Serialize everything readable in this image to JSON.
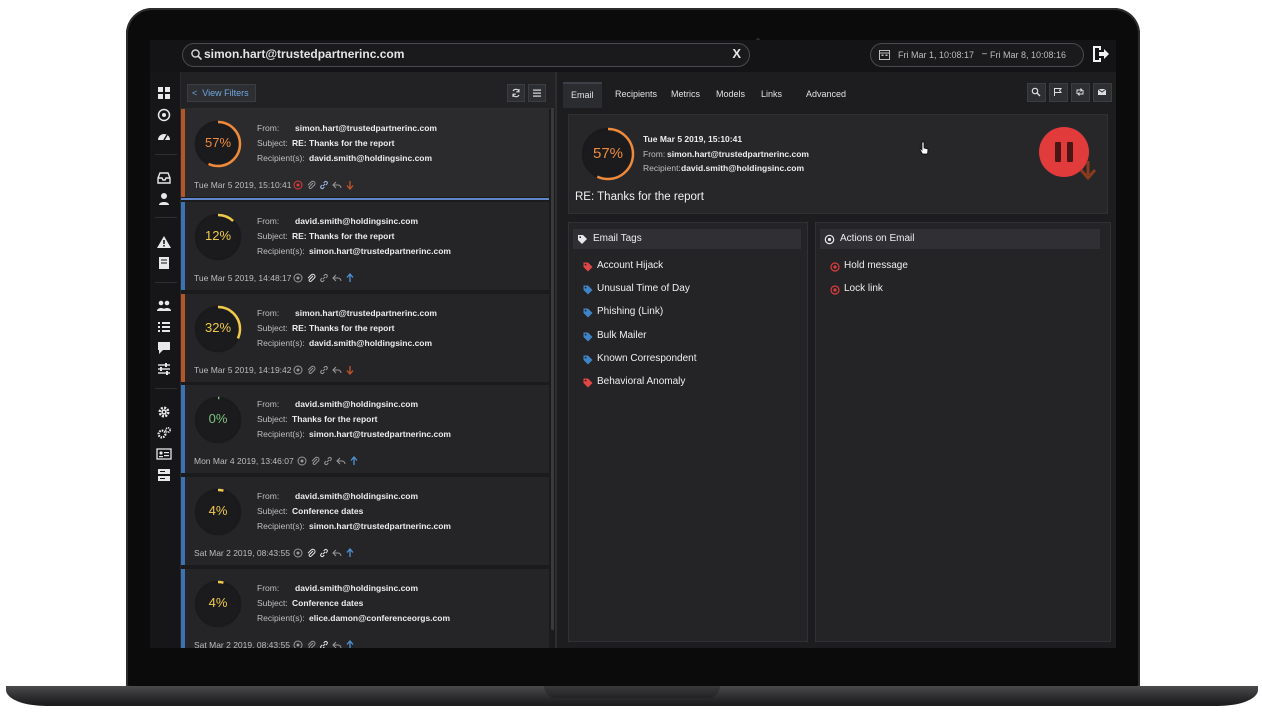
{
  "search": {
    "query": "simon.hart@trustedpartnerinc.com",
    "clear_label": "X"
  },
  "date_range": {
    "from": "Fri Mar 1, 10:08:17",
    "to": "Fri Mar 8, 10:08:16"
  },
  "list": {
    "view_filters_label": "View Filters",
    "field_labels": {
      "from": "From:",
      "subject": "Subject:",
      "recipients": "Recipient(s):"
    },
    "emails": [
      {
        "score": "57%",
        "score_value": 0.57,
        "from": "simon.hart@trustedpartnerinc.com",
        "subject": "RE: Thanks for the report",
        "recipients": "david.smith@holdingsinc.com",
        "timestamp": "Tue Mar 5 2019, 15:10:41",
        "direction": "down"
      },
      {
        "score": "12%",
        "score_value": 0.12,
        "from": "david.smith@holdingsinc.com",
        "subject": "RE: Thanks for the report",
        "recipients": "simon.hart@trustedpartnerinc.com",
        "timestamp": "Tue Mar 5 2019, 14:48:17",
        "direction": "up"
      },
      {
        "score": "32%",
        "score_value": 0.32,
        "from": "simon.hart@trustedpartnerinc.com",
        "subject": "RE: Thanks for the report",
        "recipients": "david.smith@holdingsinc.com",
        "timestamp": "Tue Mar 5 2019, 14:19:42",
        "direction": "down"
      },
      {
        "score": "0%",
        "score_value": 0.0,
        "from": "david.smith@holdingsinc.com",
        "subject": "Thanks for the report",
        "recipients": "simon.hart@trustedpartnerinc.com",
        "timestamp": "Mon Mar 4 2019, 13:46:07",
        "direction": "up"
      },
      {
        "score": "4%",
        "score_value": 0.04,
        "from": "david.smith@holdingsinc.com",
        "subject": "Conference dates",
        "recipients": "simon.hart@trustedpartnerinc.com",
        "timestamp": "Sat Mar 2 2019, 08:43:55",
        "direction": "up"
      },
      {
        "score": "4%",
        "score_value": 0.04,
        "from": "david.smith@holdingsinc.com",
        "subject": "Conference dates",
        "recipients": "elice.damon@conferenceorgs.com",
        "timestamp": "Sat Mar 2 2019, 08:43:55",
        "direction": "up"
      }
    ]
  },
  "tabs": [
    "Email",
    "Recipients",
    "Metrics",
    "Models",
    "Links",
    "Advanced"
  ],
  "detail": {
    "score": "57%",
    "score_value": 0.57,
    "date": "Tue Mar 5 2019, 15:10:41",
    "from_label": "From:",
    "from": "simon.hart@trustedpartnerinc.com",
    "recipient_label": "Recipient:",
    "recipient": "david.smith@holdingsinc.com",
    "subject": "RE: Thanks for the report"
  },
  "email_tags": {
    "title": "Email Tags",
    "items": [
      {
        "label": "Account Hijack",
        "color": "#e04646"
      },
      {
        "label": "Unusual Time of Day",
        "color": "#3f84c4"
      },
      {
        "label": "Phishing (Link)",
        "color": "#3f84c4"
      },
      {
        "label": "Bulk Mailer",
        "color": "#3f84c4"
      },
      {
        "label": "Known Correspondent",
        "color": "#3f84c4"
      },
      {
        "label": "Behavioral Anomaly",
        "color": "#e04646"
      }
    ]
  },
  "actions": {
    "title": "Actions on Email",
    "items": [
      "Hold message",
      "Lock link"
    ]
  },
  "colors": {
    "accent_blue": "#5f86c8",
    "bar_high": "#b3562a",
    "bar_low": "#3a73b4",
    "score_high": "#ef8a3a",
    "score_mid": "#f0c94a",
    "score_zero": "#7dc27d",
    "alert_red": "#e23b3b"
  }
}
